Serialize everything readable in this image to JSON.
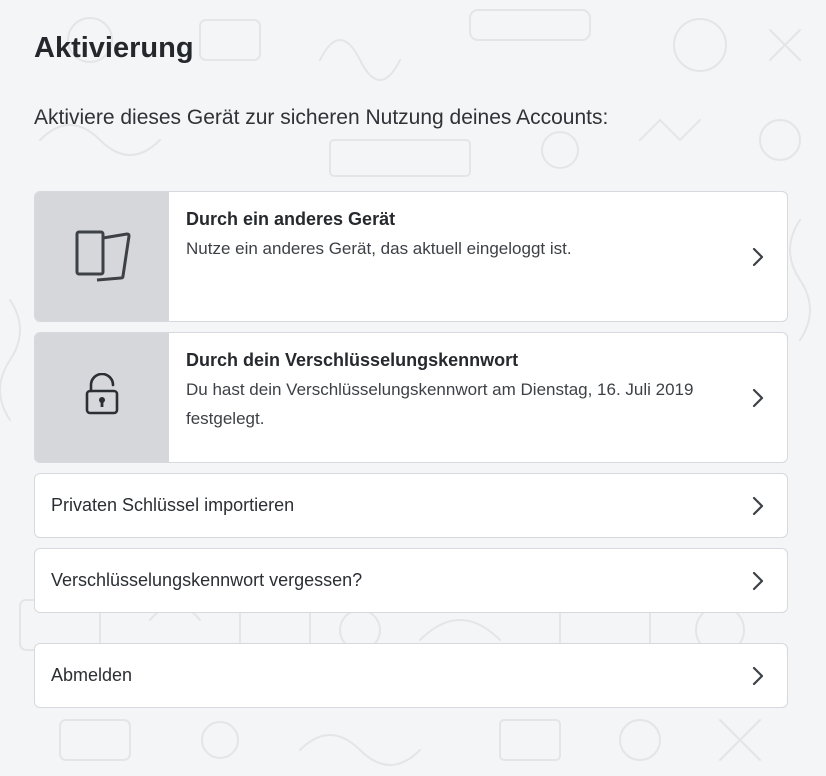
{
  "page": {
    "title": "Aktivierung",
    "intro": "Aktiviere dieses Gerät zur sicheren Nutzung deines Accounts:"
  },
  "options": [
    {
      "title": "Durch ein anderes Gerät",
      "description": "Nutze ein anderes Gerät, das aktuell eingeloggt ist.",
      "icon": "devices-icon"
    },
    {
      "title": "Durch dein Verschlüsselungskennwort",
      "description": "Du hast dein Verschlüsselungskennwort am Dienstag, 16. Juli 2019 festgelegt.",
      "icon": "unlock-icon"
    }
  ],
  "links": {
    "import_key": "Privaten Schlüssel importieren",
    "forgot_password": "Verschlüsselungskennwort vergessen?",
    "logout": "Abmelden"
  },
  "colors": {
    "background": "#f4f5f6",
    "icon_panel": "#d5d7da",
    "card": "#ffffff",
    "border": "#d6d9dd",
    "text": "#2b2e33"
  }
}
